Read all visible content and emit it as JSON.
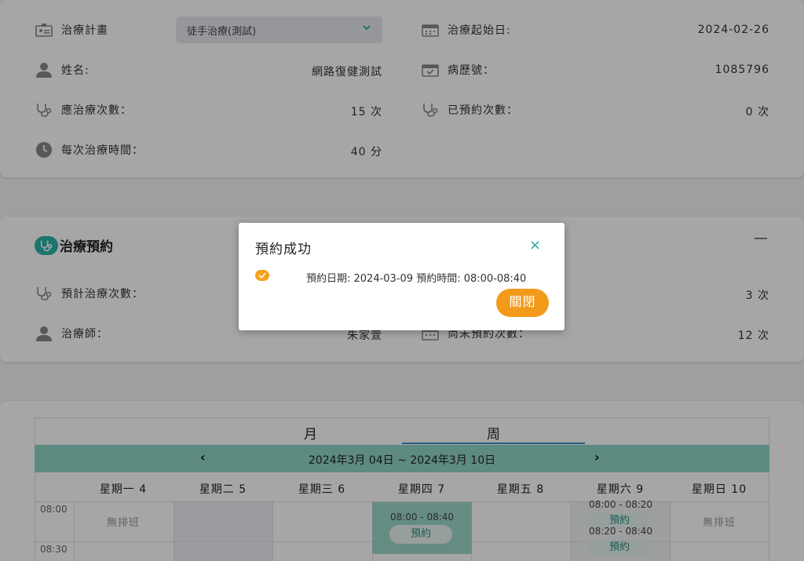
{
  "plan_card": {
    "plan_label": "治療計畫",
    "plan_select_value": "徒手治療(測試)",
    "start_date_label": "治療起始日:",
    "start_date_value": "2024-02-26",
    "name_label": "姓名:",
    "name_value": "網路復健測試",
    "record_no_label": "病歷號：",
    "record_no_value": "1085796",
    "should_count_label": "應治療次數：",
    "should_count_value": "15 次",
    "booked_count_label": "已預約次數：",
    "booked_count_value": "0 次",
    "duration_label": "每次治療時間：",
    "duration_value": "40 分"
  },
  "booking_card": {
    "title": "治療預約",
    "collapse_symbol": "—",
    "planned_count_label": "預計治療次數：",
    "planned_count_value": "3 次",
    "therapist_label": "治療師：",
    "therapist_value": "朱家萱",
    "unbooked_count_label": "尚未預約次數：",
    "unbooked_count_value": "12 次"
  },
  "calendar": {
    "tab_month": "月",
    "tab_week": "周",
    "prev_arrow": "‹",
    "next_arrow": "›",
    "range": "2024年3月 04日 ~ 2024年3月 10日",
    "days": [
      "星期一 4",
      "星期二 5",
      "星期三 6",
      "星期四 7",
      "星期五 8",
      "星期六 9",
      "星期日 10"
    ],
    "times": [
      "08:00",
      "08:30"
    ],
    "no_shift": "無排班",
    "thu_slot": "08:00 - 08:40",
    "book_label": "預約",
    "sat_slot_1": "08:00 - 08:20",
    "sat_slot_2": "08:20 - 08:40"
  },
  "modal": {
    "title": "預約成功",
    "close": "×",
    "message": "預約日期: 2024-03-09 預約時間: 08:00-08:40",
    "button": "關閉"
  },
  "colors": {
    "accent": "#2bb3a8",
    "orange": "#f39a1a",
    "nav_bg": "#8fd5c6"
  }
}
